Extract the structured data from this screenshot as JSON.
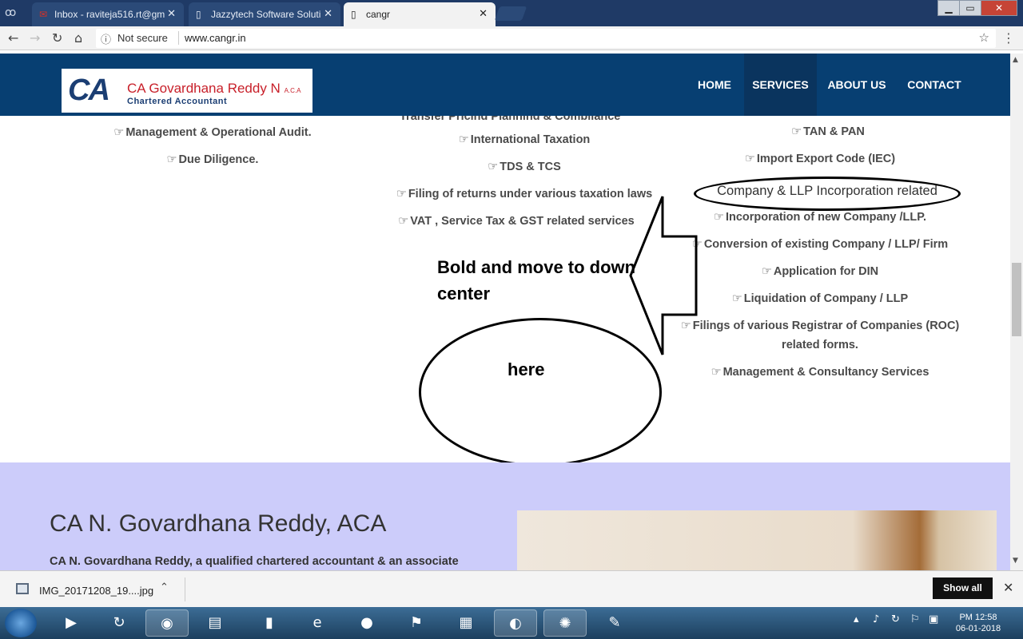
{
  "browser": {
    "tabs": [
      {
        "title": "Inbox - raviteja516.rt@gm",
        "icon": "gmail-icon"
      },
      {
        "title": "Jazzytech Software Soluti",
        "icon": "page-icon"
      },
      {
        "title": "cangr",
        "icon": "page-icon"
      }
    ],
    "security_label": "Not secure",
    "url": "www.cangr.in"
  },
  "site": {
    "logo": {
      "mark": "CA",
      "name": "CA Govardhana Reddy N",
      "suffix": "A.C.A",
      "subtitle": "Chartered Accountant"
    },
    "nav": [
      "HOME",
      "SERVICES",
      "ABOUT US",
      "CONTACT"
    ],
    "active_nav": "SERVICES"
  },
  "services": {
    "col1": [
      "Management & Operational Audit.",
      "Due Diligence."
    ],
    "col2_clipped": "Transfer Pricing Planning & Compliance",
    "col2": [
      "International Taxation",
      "TDS & TCS",
      "Filing of returns under various taxation laws",
      "VAT , Service Tax & GST related services"
    ],
    "col3_top": [
      "TAN & PAN",
      "Import Export Code (IEC)"
    ],
    "col3_heading": "Company & LLP Incorporation related",
    "col3": [
      "Incorporation of new Company /LLP.",
      "Conversion of existing Company / LLP/ Firm",
      "Application for DIN",
      "Liquidation of Company / LLP"
    ],
    "col3_roc_line1": "Filings of various Registrar of Companies (ROC)",
    "col3_roc_line2": "related forms.",
    "col3_last": "Management & Consultancy Services"
  },
  "annotation": {
    "instruction_line1": "Bold and move to down",
    "instruction_line2": "center",
    "target": "here"
  },
  "about": {
    "heading": "CA N. Govardhana Reddy, ACA",
    "text": "CA N. Govardhana Reddy, a qualified chartered accountant & an associate"
  },
  "downloads": {
    "file": "IMG_20171208_19....jpg",
    "show_all": "Show all"
  },
  "taskbar": {
    "time": "PM 12:58",
    "date": "06-01-2018"
  }
}
